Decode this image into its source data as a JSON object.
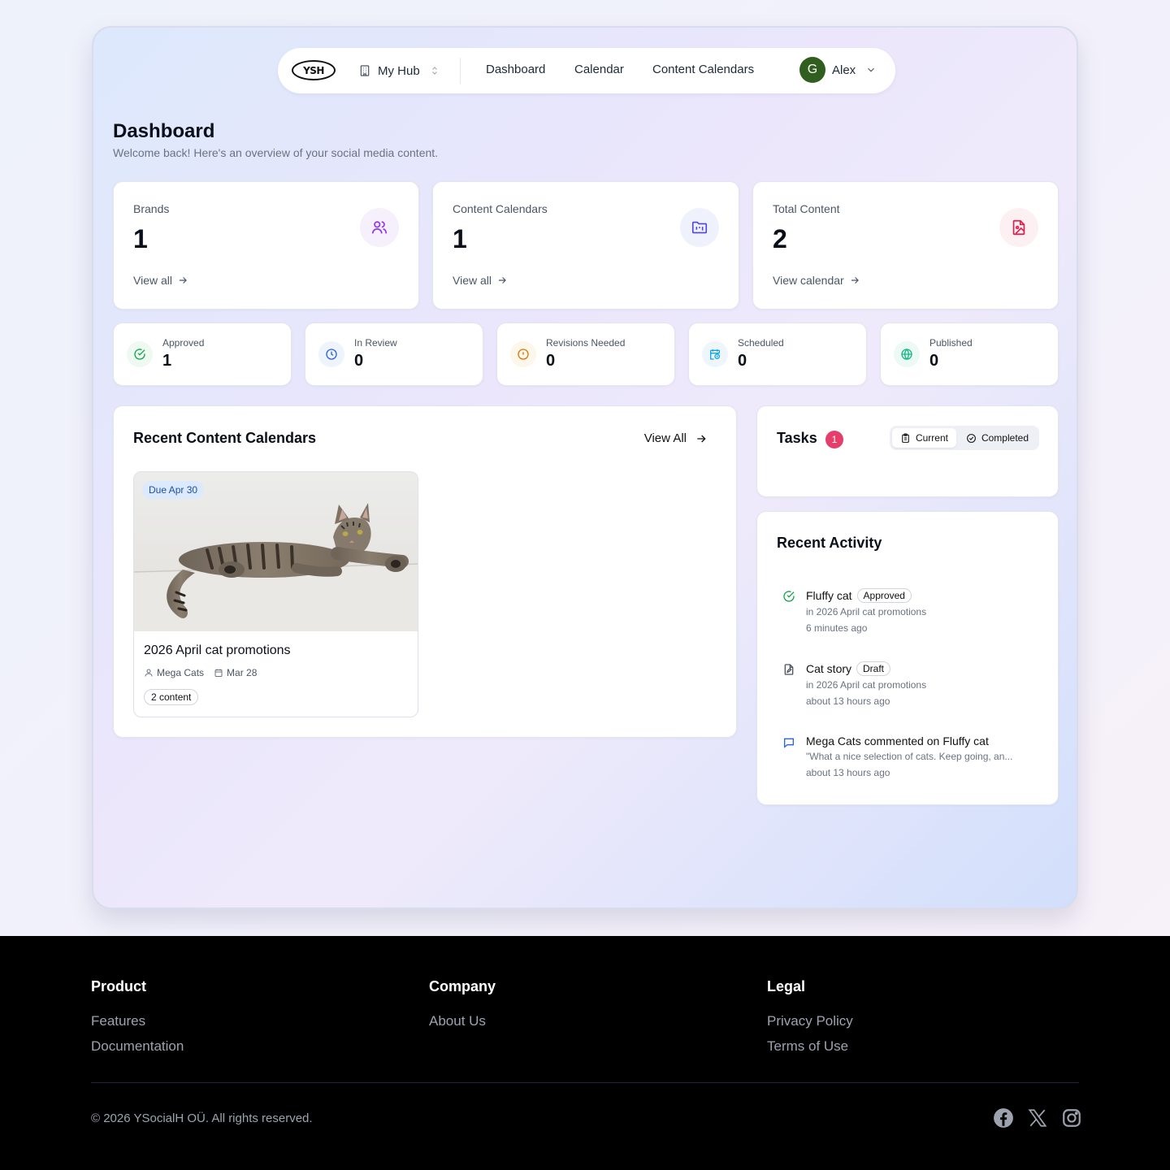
{
  "navbar": {
    "logo_text": "YSH",
    "hub_label": "My Hub",
    "links": [
      "Dashboard",
      "Calendar",
      "Content Calendars"
    ],
    "user": {
      "initial": "G",
      "name": "Alex",
      "avatar_color": "#2f5e1f"
    }
  },
  "header": {
    "title": "Dashboard",
    "subtitle": "Welcome back! Here's an overview of your social media content."
  },
  "stats": [
    {
      "label": "Brands",
      "value": "1",
      "link": "View all",
      "icon": "users-icon",
      "color": "#9333ea",
      "bg": "#f5f0fb"
    },
    {
      "label": "Content Calendars",
      "value": "1",
      "link": "View all",
      "icon": "folder-kanban-icon",
      "color": "#4f46e5",
      "bg": "#eff2fc"
    },
    {
      "label": "Total Content",
      "value": "2",
      "link": "View calendar",
      "icon": "file-image-icon",
      "color": "#e11d48",
      "bg": "#fdf0f3"
    }
  ],
  "status_counts": [
    {
      "label": "Approved",
      "value": "1",
      "icon": "check-circle-icon",
      "color": "#16a34a",
      "bg": "#eefaf1"
    },
    {
      "label": "In Review",
      "value": "0",
      "icon": "clock-icon",
      "color": "#2563eb",
      "bg": "#eef3fc"
    },
    {
      "label": "Revisions Needed",
      "value": "0",
      "icon": "alert-circle-icon",
      "color": "#d97706",
      "bg": "#fdf6ea"
    },
    {
      "label": "Scheduled",
      "value": "0",
      "icon": "calendar-clock-icon",
      "color": "#0ea5e9",
      "bg": "#eef6fc"
    },
    {
      "label": "Published",
      "value": "0",
      "icon": "globe-icon",
      "color": "#10b981",
      "bg": "#edf9f4"
    }
  ],
  "recent_calendars": {
    "title": "Recent Content Calendars",
    "view_all": "View All",
    "items": [
      {
        "due": "Due Apr 30",
        "title": "2026 April cat promotions",
        "brand": "Mega Cats",
        "date": "Mar 28",
        "content_count": "2 content"
      }
    ]
  },
  "tasks": {
    "title": "Tasks",
    "count": "1",
    "tabs": [
      "Current",
      "Completed"
    ],
    "active_tab": "Current"
  },
  "activity": {
    "title": "Recent Activity",
    "items": [
      {
        "icon": "check-circle-icon",
        "title": "Fluffy cat",
        "badge": "Approved",
        "sub": "in 2026 April cat promotions",
        "time": "6 minutes ago"
      },
      {
        "icon": "file-pen-icon",
        "title": "Cat story",
        "badge": "Draft",
        "sub": "in 2026 April cat promotions",
        "time": "about 13 hours ago"
      },
      {
        "icon": "message-square-icon",
        "actor": "Mega Cats",
        "verb": "commented on",
        "target": "Fluffy cat",
        "sub": "\"What a nice selection of cats. Keep going, an...",
        "time": "about 13 hours ago"
      }
    ]
  },
  "footer": {
    "columns": [
      {
        "heading": "Product",
        "links": [
          "Features",
          "Documentation"
        ]
      },
      {
        "heading": "Company",
        "links": [
          "About Us"
        ]
      },
      {
        "heading": "Legal",
        "links": [
          "Privacy Policy",
          "Terms of Use"
        ]
      }
    ],
    "copyright": "© 2026 YSocialH OÜ. All rights reserved.",
    "socials": [
      "facebook-icon",
      "x-icon",
      "instagram-icon"
    ]
  }
}
